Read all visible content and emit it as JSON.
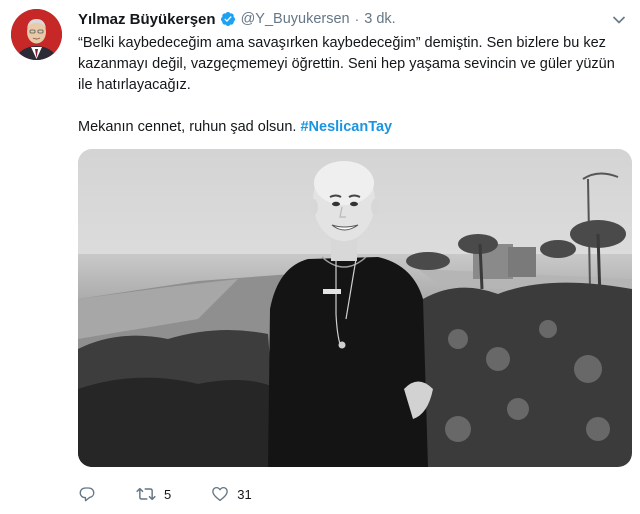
{
  "author": {
    "name": "Yılmaz Büyükerşen",
    "handle": "@Y_Buyukersen",
    "separator": "·",
    "time": "3 dk."
  },
  "tweet": {
    "line1": "“Belki kaybedeceğim ama savaşırken kaybedeceğim” demiştin. Sen bizlere bu kez kazanmayı değil, vazgeçmemeyi öğrettin. Seni hep yaşama sevincin ve güler yüzün ile hatırlayacağız.",
    "line2_text": "Mekanın cennet, ruhun şad olsun.",
    "hashtag": "#NeslicanTay"
  },
  "actions": {
    "reply_icon": "reply-icon",
    "retweet_icon": "retweet-icon",
    "retweet_count": "5",
    "like_icon": "heart-icon",
    "like_count": "31"
  },
  "colors": {
    "link": "#1b95e0",
    "secondary_text": "#657786",
    "verified_badge": "#1da1f2"
  }
}
